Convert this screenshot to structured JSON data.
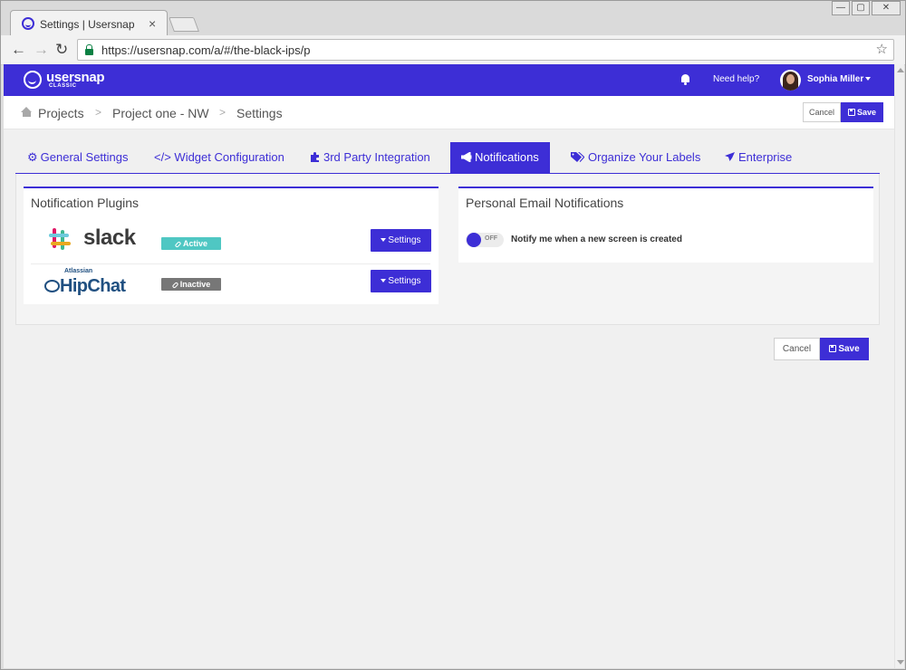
{
  "browser": {
    "tab_title": "Settings | Usersnap",
    "tab_close": "×",
    "url": "https://usersnap.com/a/#/the-black-ips/p",
    "back": "←",
    "forward": "→",
    "reload": "↻",
    "bookmark": "☆",
    "minimize": "—",
    "maximize": "▢",
    "close": "✕"
  },
  "app": {
    "brand": "usersnap",
    "brand_sub": "CLASSIC",
    "help": "Need help?",
    "user": "Sophia Miller",
    "accent": "#3d2ed6"
  },
  "breadcrumb": {
    "items": [
      "Projects",
      "Project one - NW",
      "Settings"
    ],
    "separator": ">"
  },
  "actions": {
    "cancel": "Cancel",
    "save": "Save"
  },
  "tabs": [
    {
      "label": "General Settings",
      "icon": "gear-icon"
    },
    {
      "label": "Widget Configuration",
      "icon": "code-icon",
      "prefix": "</>"
    },
    {
      "label": "3rd Party Integration",
      "icon": "puzzle-icon"
    },
    {
      "label": "Notifications",
      "icon": "bullhorn-icon",
      "active": true
    },
    {
      "label": "Organize Your Labels",
      "icon": "tags-icon"
    },
    {
      "label": "Enterprise",
      "icon": "plane-icon"
    }
  ],
  "plugins": {
    "title": "Notification Plugins",
    "items": [
      {
        "name": "slack",
        "status": "Active",
        "status_color": "#4fc7c3",
        "button": "Settings"
      },
      {
        "name": "HipChat",
        "vendor": "Atlassian",
        "status": "Inactive",
        "status_color": "#777777",
        "button": "Settings"
      }
    ]
  },
  "email": {
    "title": "Personal Email Notifications",
    "toggle_state": "OFF",
    "label": "Notify me when a new screen is created"
  }
}
